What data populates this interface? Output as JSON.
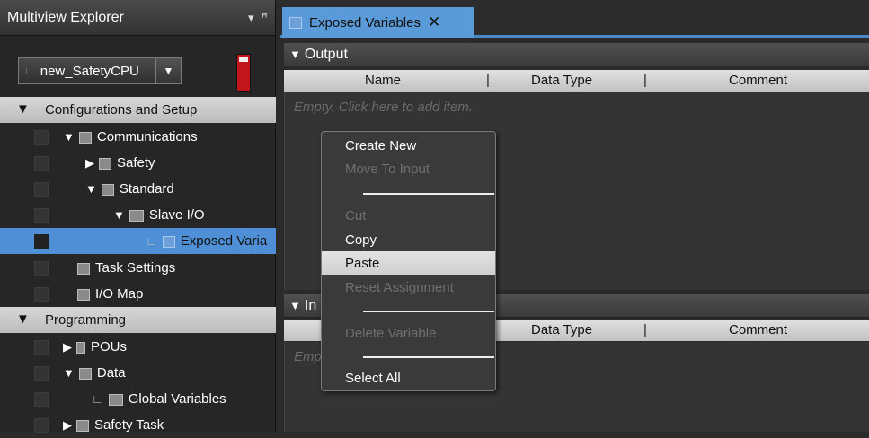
{
  "explorer": {
    "title": "Multiview Explorer",
    "pin_glyph": "⇩",
    "close_glyph": "ꟸ",
    "device": "new_SafetyCPU",
    "tree_corner": "∟",
    "tree": {
      "config_setup": "Configurations and Setup",
      "communications": "Communications",
      "safety": "Safety",
      "standard": "Standard",
      "slave_io": "Slave I/O",
      "exposed_variables": "Exposed Varia",
      "task_settings": "Task Settings",
      "io_map": "I/O Map",
      "programming": "Programming",
      "pous": "POUs",
      "data": "Data",
      "global_variables": "Global Variables",
      "safety_task": "Safety Task"
    }
  },
  "editor": {
    "tab_label": "Exposed Variables",
    "tab_close": "✕",
    "output_section": "Output",
    "input_section": "In",
    "columns": {
      "name": "Name",
      "data_type": "Data Type",
      "comment": "Comment",
      "sep": "|"
    },
    "output_empty_hint": "Empty. Click here to add item.",
    "input_empty_hint": "Emp"
  },
  "context_menu": {
    "create_new": "Create New",
    "move_to_input": "Move To Input",
    "cut": "Cut",
    "copy": "Copy",
    "paste": "Paste",
    "reset_assignment": "Reset Assignment",
    "delete_variable": "Delete Variable",
    "select_all": "Select All"
  },
  "colors": {
    "accent": "#4a86c8",
    "tab_active": "#5a9ad8",
    "selection": "#4f8fd6",
    "status_red": "#c2151b"
  },
  "icons": {
    "collapse": "▼",
    "expand": "▶",
    "dropdown": "▼"
  }
}
